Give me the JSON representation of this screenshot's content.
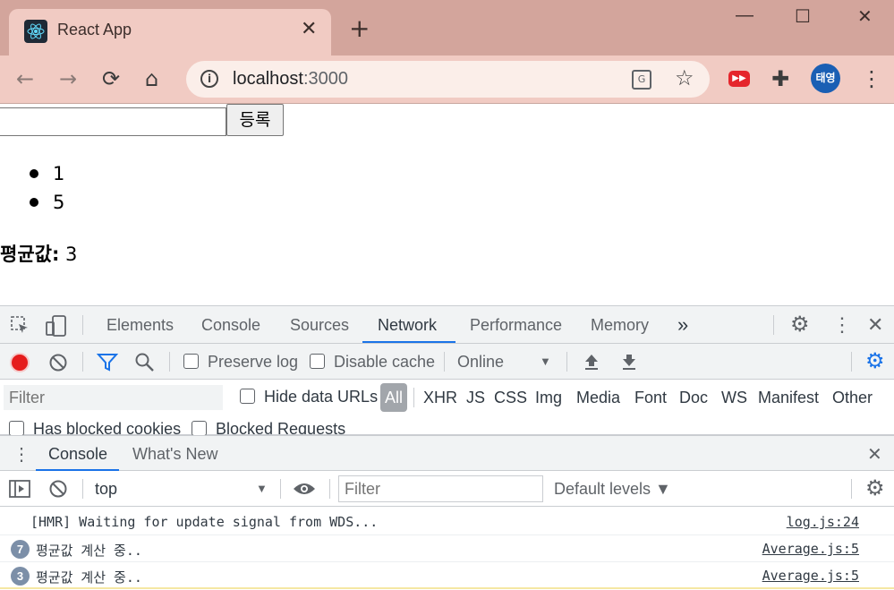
{
  "browser": {
    "tab_title": "React App",
    "tab_close": "✕",
    "new_tab": "+",
    "window": {
      "minimize": "—",
      "maximize": "☐",
      "close": "✕"
    },
    "url_host": "localhost",
    "url_port": ":3000",
    "profile_initials": "태영"
  },
  "page": {
    "submit_label": "등록",
    "input_value": "",
    "list_items": [
      "1",
      "5"
    ],
    "avg_label": "평균값:",
    "avg_value": "3"
  },
  "devtools": {
    "tabs": [
      "Elements",
      "Console",
      "Sources",
      "Network",
      "Performance",
      "Memory"
    ],
    "active_tab": "Network",
    "more_tabs": "»",
    "network": {
      "preserve_log": "Preserve log",
      "disable_cache": "Disable cache",
      "throttle": "Online",
      "filter_placeholder": "Filter",
      "hide_data_urls": "Hide data URLs",
      "all": "All",
      "types": [
        "XHR",
        "JS",
        "CSS",
        "Img",
        "Media",
        "Font",
        "Doc",
        "WS",
        "Manifest",
        "Other"
      ],
      "has_blocked_cookies": "Has blocked cookies",
      "blocked_requests": "Blocked Requests"
    },
    "drawer": {
      "tabs": [
        "Console",
        "What's New"
      ],
      "context": "top",
      "filter_placeholder": "Filter",
      "levels": "Default levels ▼"
    },
    "logs": [
      {
        "count": "",
        "message": "[HMR] Waiting for update signal from WDS...",
        "source": "log.js:24"
      },
      {
        "count": "7",
        "message": "평균값 계산 중..",
        "source": "Average.js:5"
      },
      {
        "count": "3",
        "message": "평균값 계산 중..",
        "source": "Average.js:5"
      }
    ]
  },
  "colors": {
    "titlebar": "#d3a59c",
    "tab_active": "#f1cbc3",
    "accent": "#1a73e8",
    "record": "#e51c1c"
  }
}
